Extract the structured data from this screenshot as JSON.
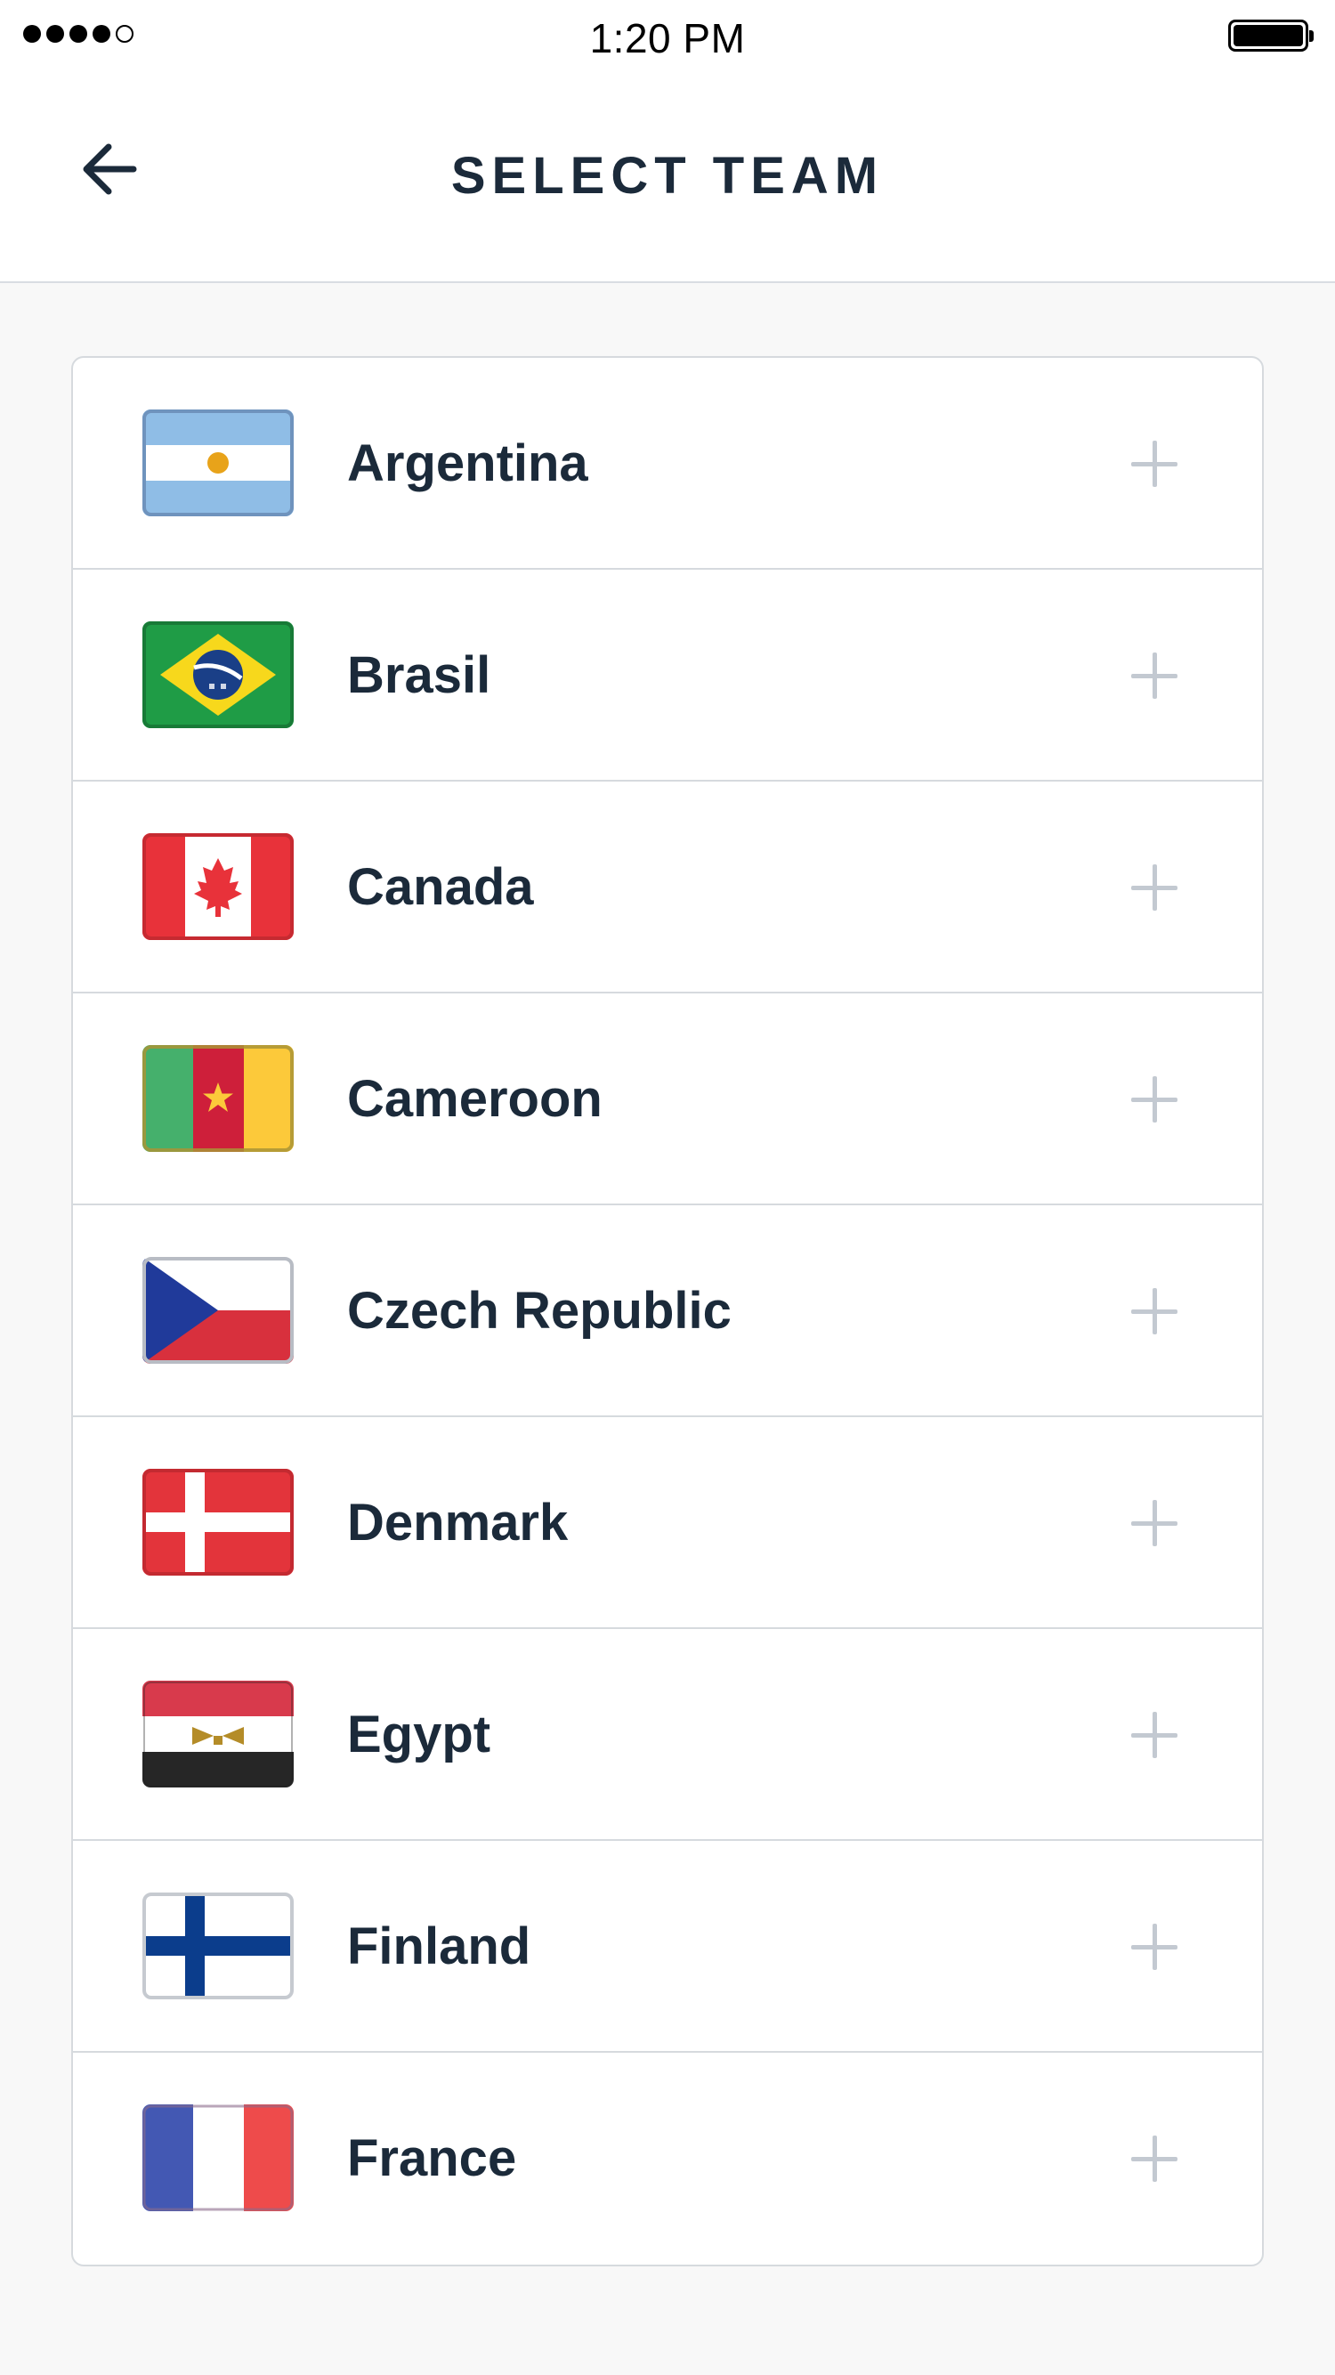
{
  "status_bar": {
    "time": "1:20 PM",
    "signal_bars_filled": 4,
    "signal_bars_total": 5,
    "battery_level": 1.0
  },
  "nav": {
    "title": "SELECT TEAM",
    "back_icon": "arrow-left-icon"
  },
  "teams": [
    {
      "name": "Argentina",
      "flag_icon": "argentina-flag-icon",
      "action_icon": "plus-icon"
    },
    {
      "name": "Brasil",
      "flag_icon": "brasil-flag-icon",
      "action_icon": "plus-icon"
    },
    {
      "name": "Canada",
      "flag_icon": "canada-flag-icon",
      "action_icon": "plus-icon"
    },
    {
      "name": "Cameroon",
      "flag_icon": "cameroon-flag-icon",
      "action_icon": "plus-icon"
    },
    {
      "name": "Czech Republic",
      "flag_icon": "czech-republic-flag-icon",
      "action_icon": "plus-icon"
    },
    {
      "name": "Denmark",
      "flag_icon": "denmark-flag-icon",
      "action_icon": "plus-icon"
    },
    {
      "name": "Egypt",
      "flag_icon": "egypt-flag-icon",
      "action_icon": "plus-icon"
    },
    {
      "name": "Finland",
      "flag_icon": "finland-flag-icon",
      "action_icon": "plus-icon"
    },
    {
      "name": "France",
      "flag_icon": "france-flag-icon",
      "action_icon": "plus-icon"
    }
  ],
  "colors": {
    "text_primary": "#1b2a3a",
    "plus_icon": "#c3c9d1",
    "divider": "#d6dade",
    "background": "#f8f8f8"
  }
}
